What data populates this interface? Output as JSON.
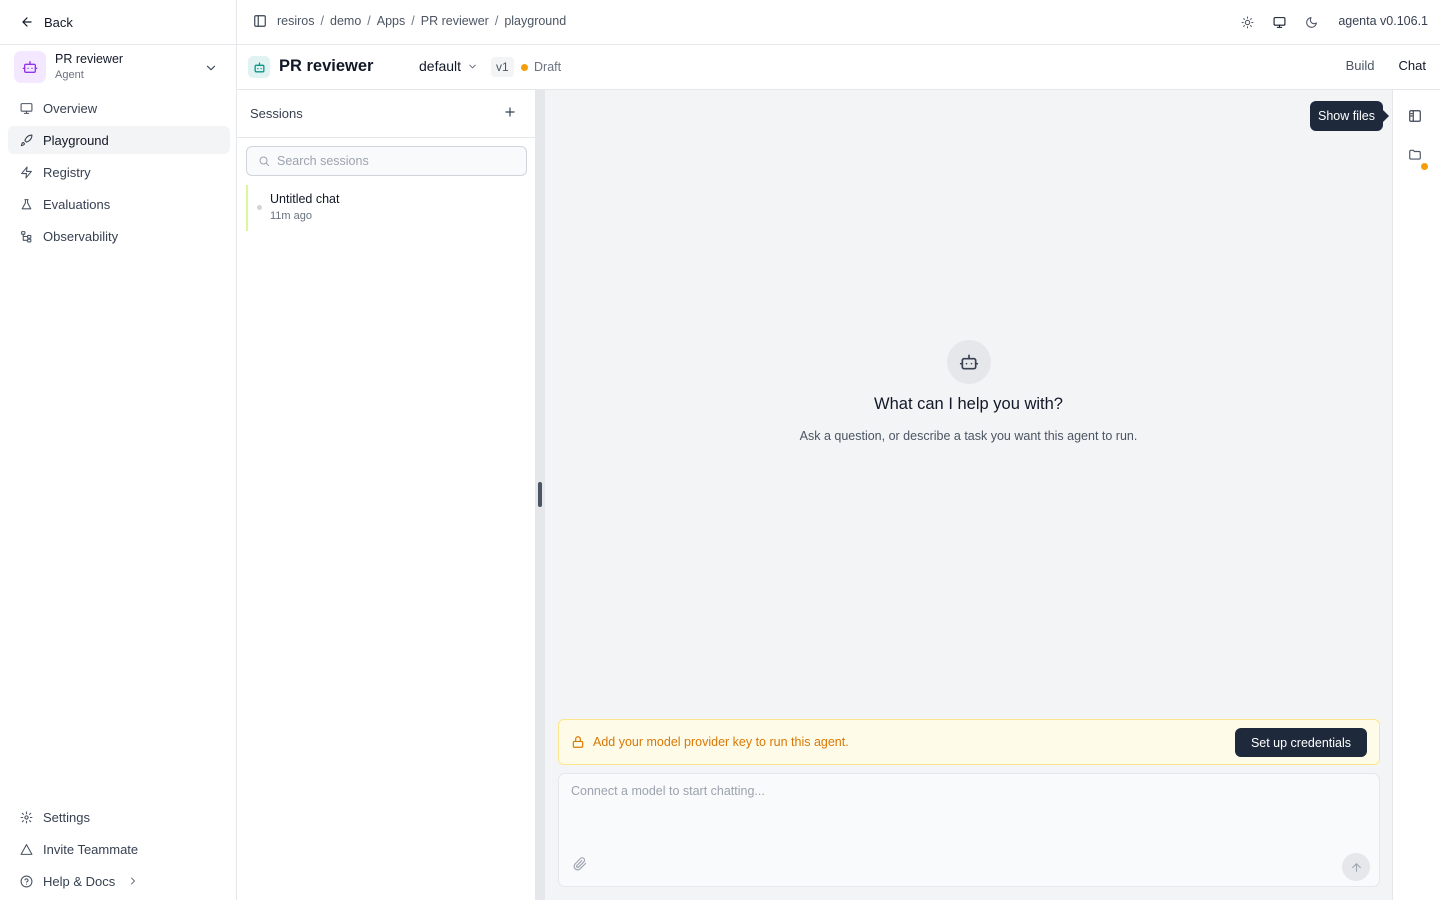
{
  "sidebar": {
    "back_label": "Back",
    "app": {
      "name": "PR reviewer",
      "type": "Agent"
    },
    "nav": [
      {
        "label": "Overview",
        "icon": "monitor-icon",
        "active": false
      },
      {
        "label": "Playground",
        "icon": "rocket-icon",
        "active": true
      },
      {
        "label": "Registry",
        "icon": "lightning-icon",
        "active": false
      },
      {
        "label": "Evaluations",
        "icon": "flask-icon",
        "active": false
      },
      {
        "label": "Observability",
        "icon": "tree-icon",
        "active": false
      }
    ],
    "bottom": [
      {
        "label": "Settings",
        "icon": "gear-icon"
      },
      {
        "label": "Invite Teammate",
        "icon": "triangle-icon"
      },
      {
        "label": "Help & Docs",
        "icon": "help-icon"
      }
    ]
  },
  "header": {
    "breadcrumb": [
      "resiros",
      "demo",
      "Apps",
      "PR reviewer",
      "playground"
    ],
    "version": "agenta v0.106.1"
  },
  "appbar": {
    "title": "PR reviewer",
    "variant": "default",
    "revision": "v1",
    "status": "Draft",
    "tabs": [
      "Build",
      "Chat"
    ],
    "active_tab": "Chat"
  },
  "sessions": {
    "title": "Sessions",
    "search_placeholder": "Search sessions",
    "items": [
      {
        "title": "Untitled chat",
        "time": "11m ago"
      }
    ]
  },
  "chat": {
    "empty_title": "What can I help you with?",
    "empty_subtitle": "Ask a question, or describe a task you want this agent to run.",
    "banner_text": "Add your model provider key to run this agent.",
    "banner_button": "Set up credentials",
    "composer_placeholder": "Connect a model to start chatting..."
  },
  "rail": {
    "tooltip": "Show files"
  },
  "colors": {
    "accent_warning": "#f59e0b",
    "dark_button": "#1e293b",
    "app_icon_bg": "#f3e8ff",
    "agent_icon_color": "#0d9488"
  }
}
